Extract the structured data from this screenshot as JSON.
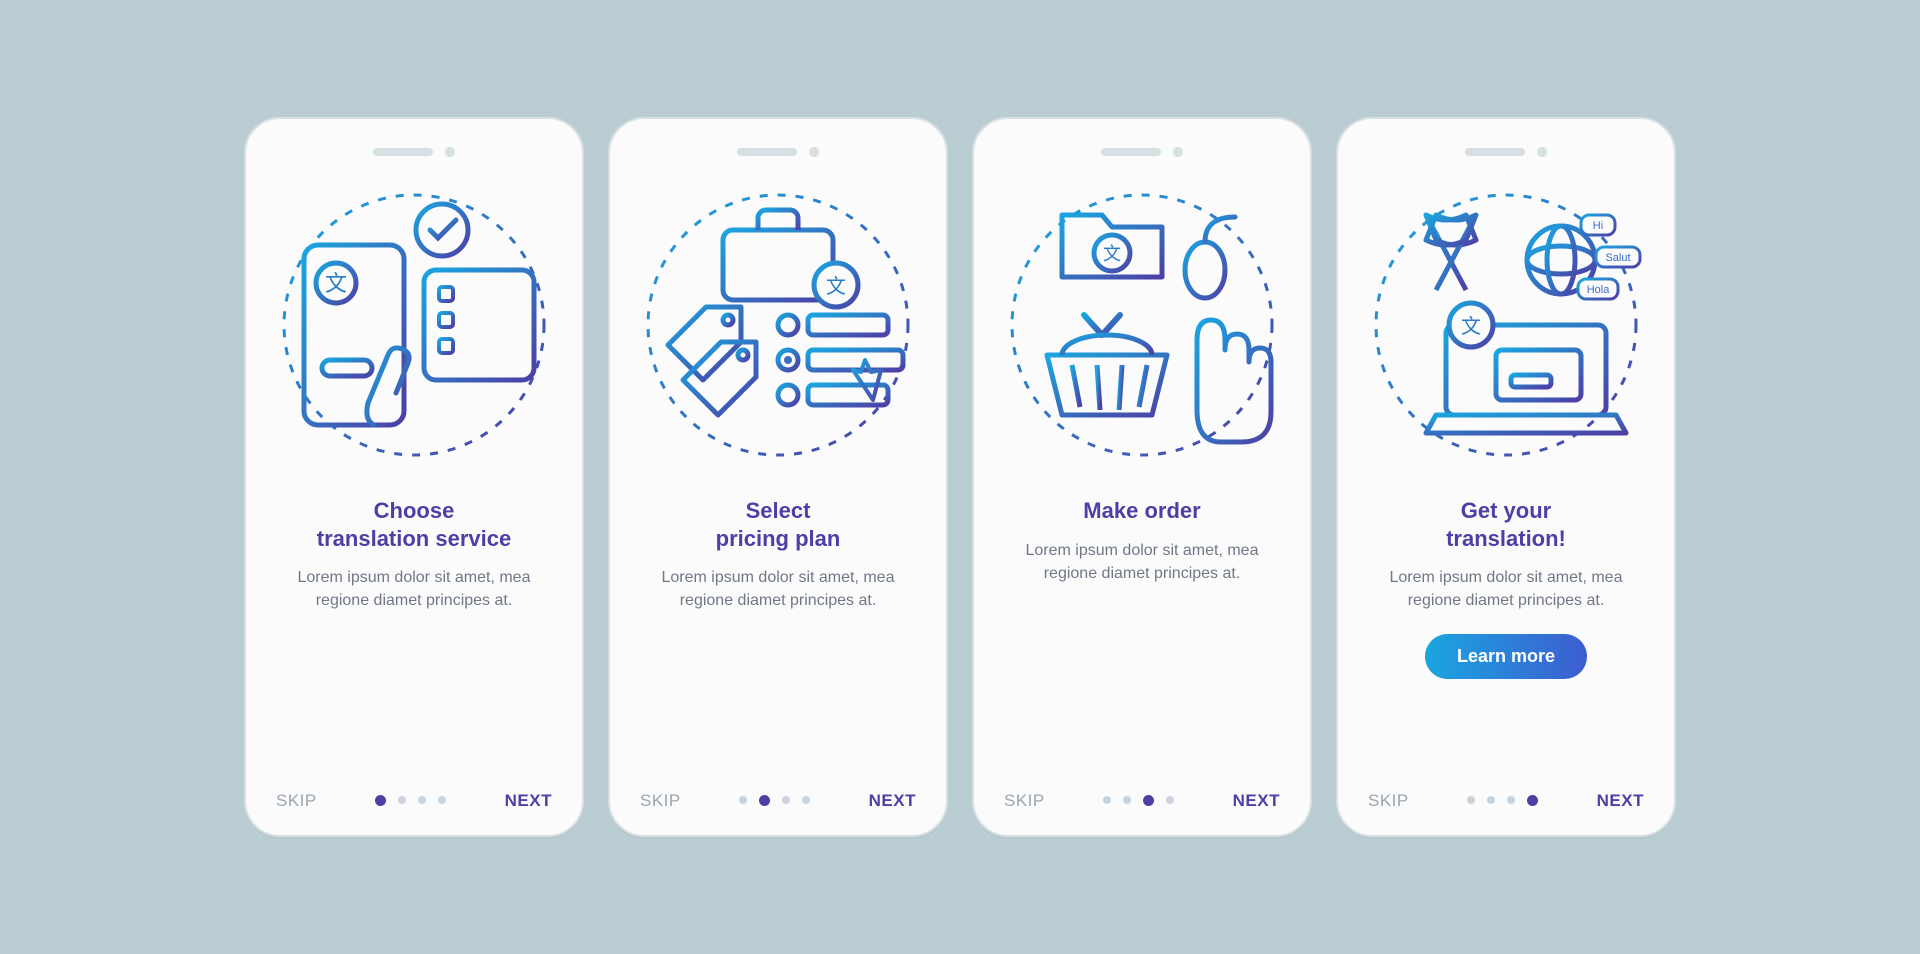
{
  "common": {
    "skip": "SKIP",
    "next": "NEXT",
    "dotCount": 4
  },
  "screens": [
    {
      "title": "Choose\ntranslation service",
      "desc": "Lorem ipsum dolor sit amet, mea regione diamet principes at.",
      "activeDot": 0,
      "cta": null,
      "illustration": "choose-service"
    },
    {
      "title": "Select\npricing plan",
      "desc": "Lorem ipsum dolor sit amet, mea regione diamet principes at.",
      "activeDot": 1,
      "cta": null,
      "illustration": "select-pricing"
    },
    {
      "title": "Make order",
      "desc": "Lorem ipsum dolor sit amet, mea regione diamet principes at.",
      "activeDot": 2,
      "cta": null,
      "illustration": "make-order"
    },
    {
      "title": "Get your\ntranslation!",
      "desc": "Lorem ipsum dolor sit amet, mea regione diamet principes at.",
      "activeDot": 3,
      "cta": "Learn more",
      "illustration": "get-translation",
      "bubbles": [
        "Hi",
        "Salut",
        "Hola"
      ]
    }
  ]
}
